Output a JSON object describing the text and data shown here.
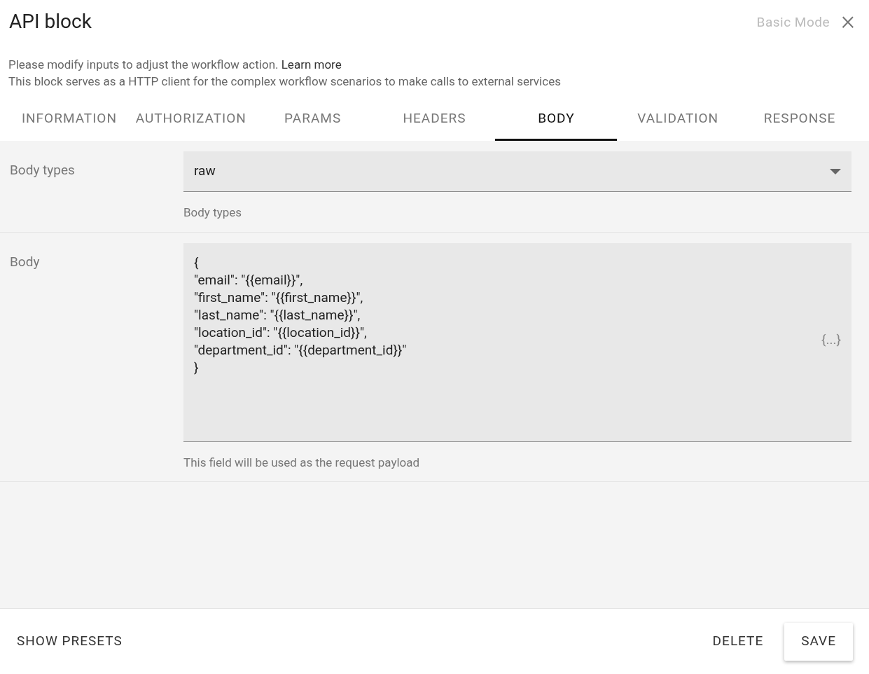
{
  "dialog": {
    "title": "API block",
    "mode_toggle": "Basic Mode",
    "close": "×"
  },
  "description": {
    "line_1": "Please modify inputs to adjust the workflow action.",
    "link": "Learn more",
    "line_2": "This block serves as a HTTP client for the complex workflow scenarios to make calls to external services"
  },
  "tabs": [
    {
      "label": "INFORMATION",
      "selected": false
    },
    {
      "label": "AUTHORIZATION",
      "selected": false
    },
    {
      "label": "PARAMS",
      "selected": false
    },
    {
      "label": "HEADERS",
      "selected": false
    },
    {
      "label": "BODY",
      "selected": true
    },
    {
      "label": "VALIDATION",
      "selected": false
    },
    {
      "label": "RESPONSE",
      "selected": false
    }
  ],
  "fields": [
    {
      "kind": "select",
      "label": "Body types",
      "value": "raw",
      "helper": "Body types"
    },
    {
      "kind": "code",
      "label": "Body",
      "value": "{\n\"email\": \"{{email}}\",\n\"first_name\": \"{{first_name}}\",\n\"last_name\": \"{{last_name}}\",\n\"location_id\": \"{{location_id}}\",\n\"department_id\": \"{{department_id}}\"\n}",
      "insert_label": "{...}",
      "helper": "This field will be used as the request payload"
    }
  ],
  "footer": {
    "left_button": "SHOW PRESETS",
    "buttons": [
      "DELETE",
      "SAVE"
    ]
  }
}
